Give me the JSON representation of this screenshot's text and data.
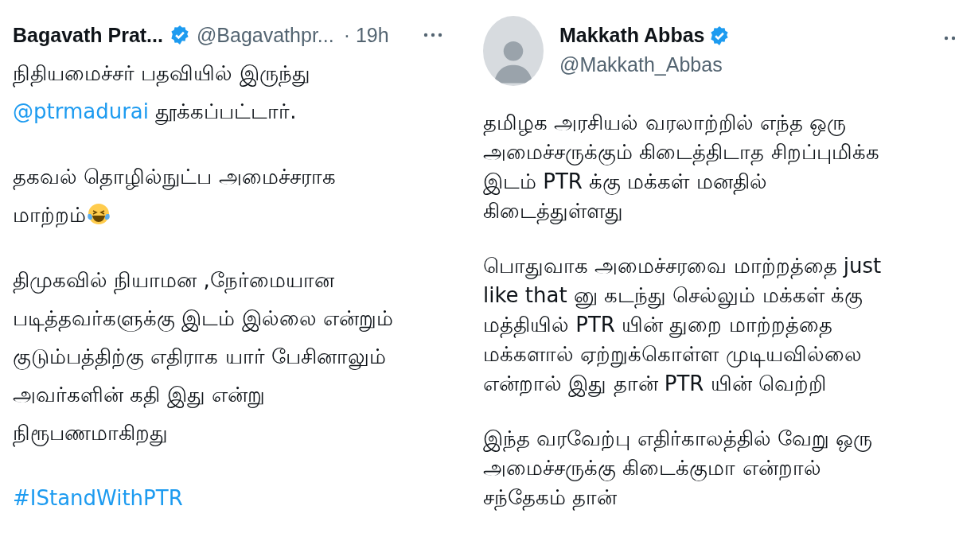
{
  "tweets": [
    {
      "name": "Bagavath Prat...",
      "verified": true,
      "handle": "@Bagavathpr...",
      "time": "· 19h",
      "kind": "inline",
      "paragraphs": [
        [
          {
            "kind": "text",
            "text": "நிதியமைச்சர் பதவியில் இருந்து\n"
          },
          {
            "kind": "mention",
            "text": "@ptrmadurai"
          },
          {
            "kind": "text",
            "text": "  தூக்கப்பட்டார்."
          }
        ],
        [
          {
            "kind": "text",
            "text": "தகவல் தொழில்நுட்ப அமைச்சராக\nமாற்றம்"
          },
          {
            "kind": "laughing-emoji"
          }
        ],
        [
          {
            "kind": "text",
            "text": "திமுகவில் நியாமன ,நேர்மையான\nபடித்தவர்களுக்கு இடம் இல்லை என்றும்\nகுடும்பத்திற்கு எதிராக யார் பேசினாலும்\nஅவர்களின் கதி இது என்று\nநிரூபணமாகிறது"
          }
        ],
        [
          {
            "kind": "mention",
            "text": "#IStandWithPTR"
          }
        ]
      ]
    },
    {
      "name": "Makkath Abbas",
      "verified": true,
      "handle": "@Makkath_Abbas",
      "kind": "stacked",
      "paragraphs": [
        [
          {
            "kind": "text",
            "text": "தமிழக அரசியல் வரலாற்றில் எந்த ஒரு\nஅமைச்சருக்கும் கிடைத்திடாத சிறப்புமிக்க\nஇடம் PTR க்கு மக்கள் மனதில்\nகிடைத்துள்ளது"
          }
        ],
        [
          {
            "kind": "text",
            "text": "பொதுவாக அமைச்சரவை மாற்றத்தை just\nlike that னு கடந்து செல்லும் மக்கள் க்கு\nமத்தியில் PTR யின் துறை மாற்றத்தை\nமக்களால் ஏற்றுக்கொள்ள முடியவில்லை\nஎன்றால் இது தான் PTR யின் வெற்றி"
          }
        ],
        [
          {
            "kind": "text",
            "text": "இந்த வரவேற்பு எதிர்காலத்தில் வேறு ஒரு\nஅமைச்சருக்கு கிடைக்குமா என்றால்\nசந்தேகம் தான்"
          }
        ]
      ]
    }
  ]
}
